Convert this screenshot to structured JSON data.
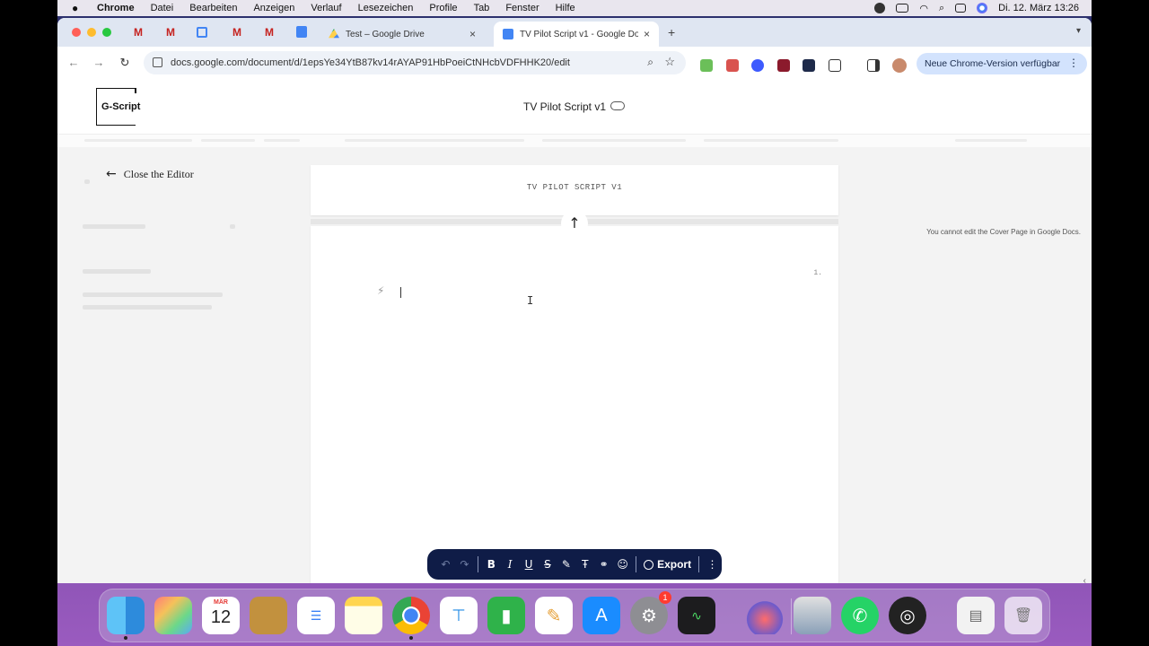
{
  "menubar": {
    "app": "Chrome",
    "items": [
      "Datei",
      "Bearbeiten",
      "Anzeigen",
      "Verlauf",
      "Lesezeichen",
      "Profile",
      "Tab",
      "Fenster",
      "Hilfe"
    ],
    "clock": "Di. 12. März  13:26"
  },
  "tabs": {
    "inactive_label": "Test – Google Drive",
    "active_label": "TV Pilot Script v1 - Google Do",
    "new_tab": "+",
    "close": "×"
  },
  "omnibox": {
    "url": "docs.google.com/document/d/1epsYe34YtB87kv14rAYAP91HbPoeiCtNHcbVDFHHK20/edit"
  },
  "update_pill": {
    "label": "Neue Chrome-Version verfügbar"
  },
  "app_header": {
    "logo": "G-Script",
    "doc_title": "TV Pilot Script v1"
  },
  "editor": {
    "close_label": "Close the Editor",
    "cover_title": "TV PILOT SCRIPT V1",
    "page_number": "1.",
    "cover_note": "You cannot edit the Cover Page in Google Docs."
  },
  "format_toolbar": {
    "export_label": "Export",
    "buttons": {
      "bold": "B",
      "italic": "I",
      "underline": "U",
      "strike": "S",
      "text_style": "Ŧ"
    }
  },
  "dock": {
    "calendar_month": "MÄR",
    "calendar_day": "12",
    "settings_badge": "1"
  }
}
